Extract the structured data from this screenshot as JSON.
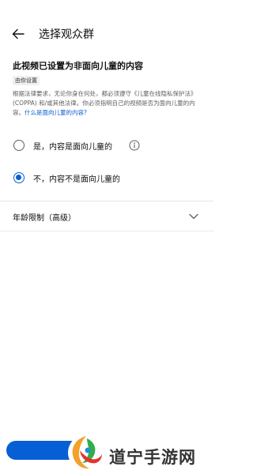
{
  "header": {
    "title": "选择观众群",
    "back_icon": "arrow-left-icon"
  },
  "status": {
    "title": "此视频已设置为非面向儿童的内容",
    "chip": "由你设置"
  },
  "legal": {
    "text": "根据法律要求，无论你身在何处，都必须遵守《儿童在线隐私保护法》(COPPA) 和/或其他法律。你必须指明自己的视频是否为面向儿童的内容。",
    "link": "什么是面向儿童的内容?"
  },
  "options": [
    {
      "label": "是，内容是面向儿童的",
      "checked": false,
      "info_icon": "info-icon"
    },
    {
      "label": "不，内容不是面向儿童的",
      "checked": true
    }
  ],
  "age_restriction": {
    "label": "年龄限制（高级）",
    "icon": "chevron-down-icon"
  },
  "watermark": {
    "text": "道宁手游网"
  },
  "colors": {
    "accent": "#065fd4",
    "text_secondary": "#606060"
  }
}
